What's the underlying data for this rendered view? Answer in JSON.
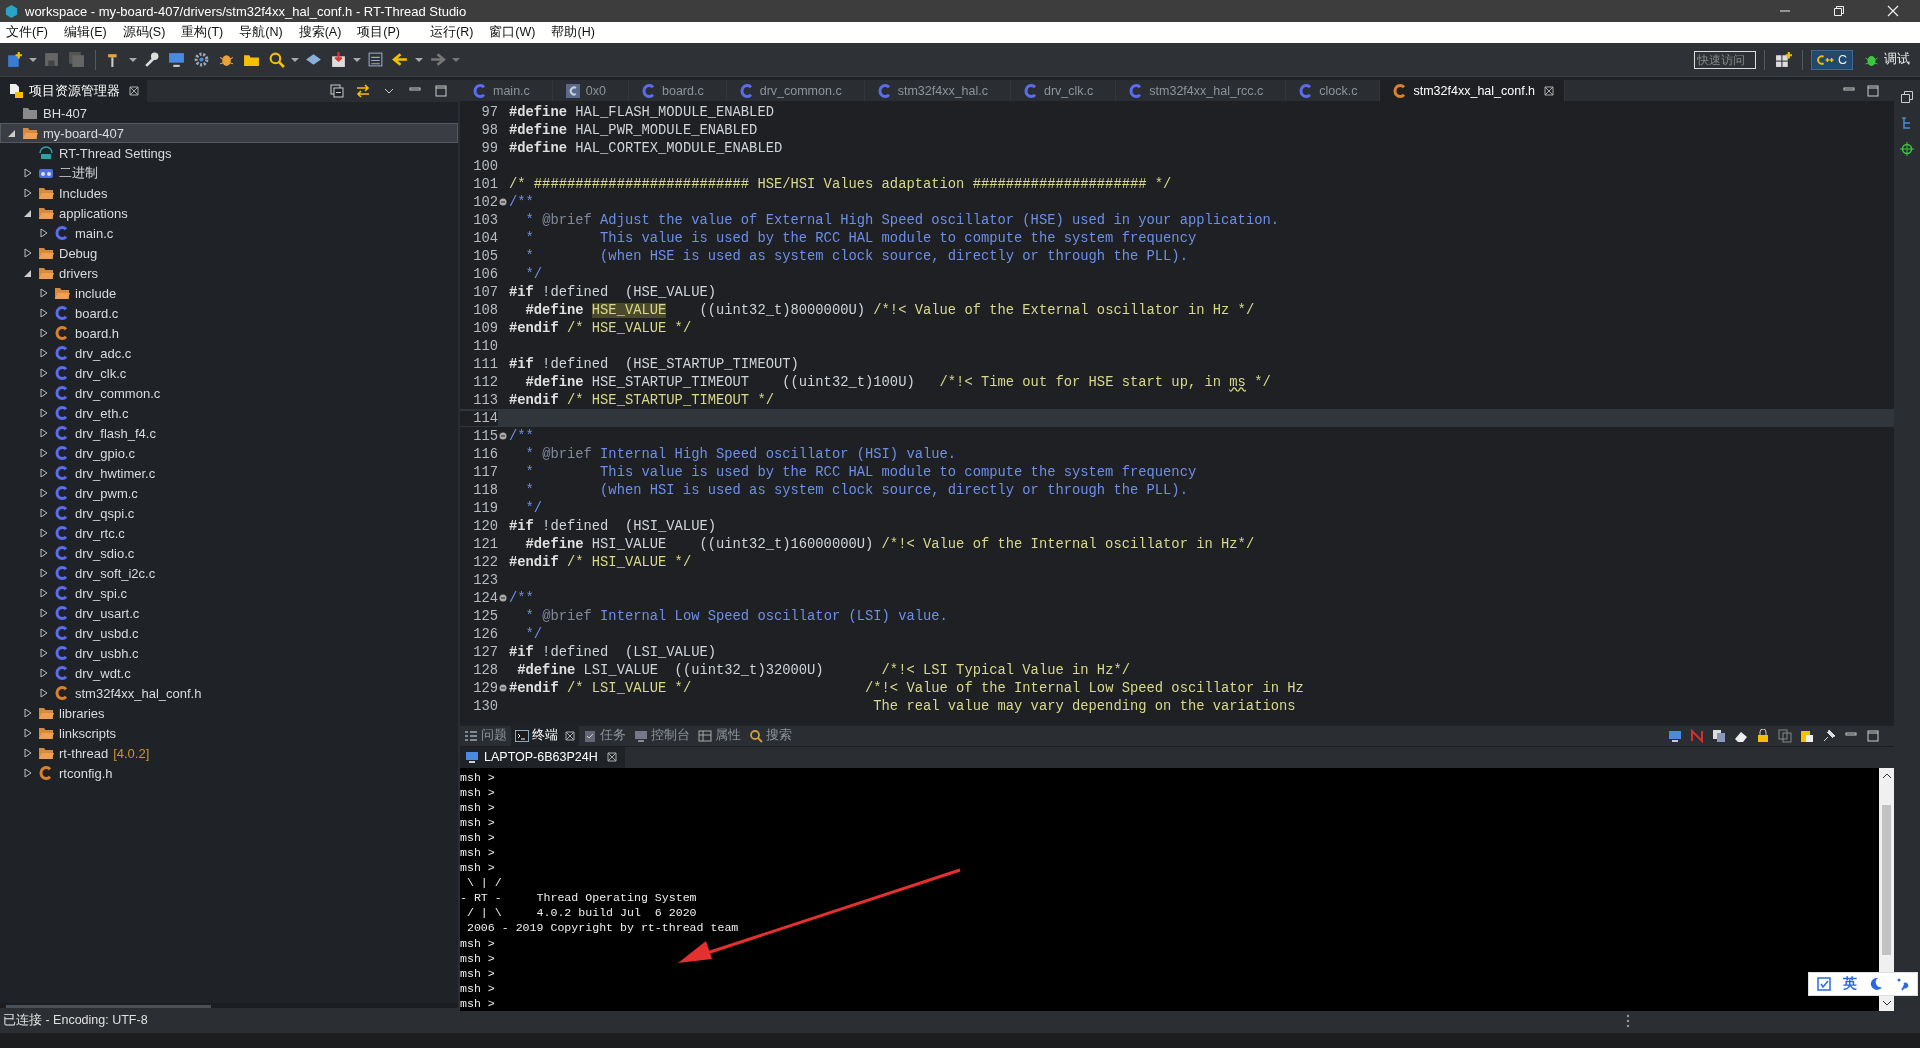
{
  "window": {
    "title": "workspace - my-board-407/drivers/stm32f4xx_hal_conf.h - RT-Thread Studio"
  },
  "menu": [
    "文件(F)",
    "编辑(E)",
    "源码(S)",
    "重构(T)",
    "导航(N)",
    "搜索(A)",
    "项目(P)",
    "运行(R)",
    "窗口(W)",
    "帮助(H)"
  ],
  "toolbar": {
    "quick_access": {
      "placeholder": "快速访问"
    },
    "perspectives": [
      {
        "label": "C",
        "kind": "cpp",
        "selected": true
      },
      {
        "label": "调试",
        "kind": "debug",
        "selected": false
      }
    ]
  },
  "explorer": {
    "title": "项目资源管理器",
    "items": [
      {
        "label": "BH-407",
        "kind": "closed-project",
        "selected": false
      },
      {
        "label": "my-board-407",
        "kind": "project",
        "selected": true,
        "expanded": true,
        "children": [
          {
            "label": "RT-Thread Settings",
            "kind": "settings",
            "selected": false
          },
          {
            "label": "二进制",
            "kind": "binaries",
            "selected": false,
            "expanded": false
          },
          {
            "label": "Includes",
            "kind": "includes",
            "selected": false,
            "expanded": false
          },
          {
            "label": "applications",
            "kind": "folder",
            "selected": false,
            "expanded": true,
            "children": [
              {
                "label": "main.c",
                "kind": "source",
                "selected": false,
                "expanded": false
              }
            ]
          },
          {
            "label": "Debug",
            "kind": "folder",
            "selected": false,
            "expanded": false
          },
          {
            "label": "drivers",
            "kind": "folder",
            "selected": false,
            "expanded": true,
            "children": [
              {
                "label": "include",
                "kind": "folder",
                "selected": false,
                "expanded": false
              },
              {
                "label": "board.c",
                "kind": "source",
                "selected": false,
                "expanded": false
              },
              {
                "label": "board.h",
                "kind": "header",
                "selected": false,
                "expanded": false
              },
              {
                "label": "drv_adc.c",
                "kind": "source",
                "selected": false,
                "expanded": false
              },
              {
                "label": "drv_clk.c",
                "kind": "source",
                "selected": false,
                "expanded": false
              },
              {
                "label": "drv_common.c",
                "kind": "source",
                "selected": false,
                "expanded": false
              },
              {
                "label": "drv_eth.c",
                "kind": "source",
                "selected": false,
                "expanded": false
              },
              {
                "label": "drv_flash_f4.c",
                "kind": "source",
                "selected": false,
                "expanded": false
              },
              {
                "label": "drv_gpio.c",
                "kind": "source",
                "selected": false,
                "expanded": false
              },
              {
                "label": "drv_hwtimer.c",
                "kind": "source",
                "selected": false,
                "expanded": false
              },
              {
                "label": "drv_pwm.c",
                "kind": "source",
                "selected": false,
                "expanded": false
              },
              {
                "label": "drv_qspi.c",
                "kind": "source",
                "selected": false,
                "expanded": false
              },
              {
                "label": "drv_rtc.c",
                "kind": "source",
                "selected": false,
                "expanded": false
              },
              {
                "label": "drv_sdio.c",
                "kind": "source",
                "selected": false,
                "expanded": false
              },
              {
                "label": "drv_soft_i2c.c",
                "kind": "source",
                "selected": false,
                "expanded": false
              },
              {
                "label": "drv_spi.c",
                "kind": "source",
                "selected": false,
                "expanded": false
              },
              {
                "label": "drv_usart.c",
                "kind": "source",
                "selected": false,
                "expanded": false
              },
              {
                "label": "drv_usbd.c",
                "kind": "source",
                "selected": false,
                "expanded": false
              },
              {
                "label": "drv_usbh.c",
                "kind": "source",
                "selected": false,
                "expanded": false
              },
              {
                "label": "drv_wdt.c",
                "kind": "source",
                "selected": false,
                "expanded": false
              },
              {
                "label": "stm32f4xx_hal_conf.h",
                "kind": "header",
                "selected": false,
                "expanded": false
              }
            ]
          },
          {
            "label": "libraries",
            "kind": "folder",
            "selected": false,
            "expanded": false
          },
          {
            "label": "linkscripts",
            "kind": "folder",
            "selected": false,
            "expanded": false
          },
          {
            "label": "rt-thread",
            "version": "[4.0.2]",
            "kind": "folder",
            "selected": false,
            "expanded": false
          },
          {
            "label": "rtconfig.h",
            "kind": "header",
            "selected": false,
            "expanded": false
          }
        ]
      }
    ]
  },
  "editor": {
    "tabs": [
      {
        "label": "main.c",
        "kind": "source",
        "selected": false
      },
      {
        "label": "0x0",
        "kind": "disassembly",
        "selected": false
      },
      {
        "label": "board.c",
        "kind": "source",
        "selected": false
      },
      {
        "label": "drv_common.c",
        "kind": "source",
        "selected": false
      },
      {
        "label": "stm32f4xx_hal.c",
        "kind": "source",
        "selected": false
      },
      {
        "label": "drv_clk.c",
        "kind": "source",
        "selected": false
      },
      {
        "label": "stm32f4xx_hal_rcc.c",
        "kind": "source",
        "selected": false
      },
      {
        "label": "clock.c",
        "kind": "source",
        "selected": false
      },
      {
        "label": "stm32f4xx_hal_conf.h",
        "kind": "header",
        "selected": true
      }
    ],
    "lines": [
      {
        "number": "97",
        "segments": [
          {
            "kind": "directive",
            "text": "#define"
          },
          {
            "kind": "plain",
            "text": " HAL_FLASH_MODULE_ENABLED"
          }
        ]
      },
      {
        "number": "98",
        "segments": [
          {
            "kind": "directive",
            "text": "#define"
          },
          {
            "kind": "plain",
            "text": " HAL_PWR_MODULE_ENABLED"
          }
        ]
      },
      {
        "number": "99",
        "segments": [
          {
            "kind": "directive",
            "text": "#define"
          },
          {
            "kind": "plain",
            "text": " HAL_CORTEX_MODULE_ENABLED"
          }
        ]
      },
      {
        "number": "100"
      },
      {
        "number": "101",
        "segments": [
          {
            "kind": "comment",
            "text": "/* ########################## HSE/HSI Values adaptation ##################### */"
          }
        ]
      },
      {
        "number": "102",
        "fold": true,
        "segments": [
          {
            "kind": "doc",
            "text": "/**"
          }
        ]
      },
      {
        "number": "103",
        "segments": [
          {
            "kind": "doc",
            "text": "  * "
          },
          {
            "kind": "doctag",
            "text": "@brief"
          },
          {
            "kind": "doc",
            "text": " Adjust the value of External High Speed oscillator (HSE) used in your application."
          }
        ]
      },
      {
        "number": "104",
        "segments": [
          {
            "kind": "doc",
            "text": "  *        This value is used by the RCC HAL module to compute the system frequency"
          }
        ]
      },
      {
        "number": "105",
        "segments": [
          {
            "kind": "doc",
            "text": "  *        (when HSE is used as system clock source, directly or through the PLL)."
          }
        ]
      },
      {
        "number": "106",
        "segments": [
          {
            "kind": "doc",
            "text": "  */"
          }
        ]
      },
      {
        "number": "107",
        "segments": [
          {
            "kind": "directive",
            "text": "#if"
          },
          {
            "kind": "plain",
            "text": " !defined  (HSE_VALUE)"
          }
        ]
      },
      {
        "number": "108",
        "segments": [
          {
            "kind": "directive",
            "text": "  #define "
          },
          {
            "kind": "match",
            "text": "HSE_VALUE"
          },
          {
            "kind": "plain",
            "text": "    ((uint32_t)8000000U) "
          },
          {
            "kind": "comment",
            "text": "/*!< Value of the External oscillator in Hz */"
          }
        ]
      },
      {
        "number": "109",
        "segments": [
          {
            "kind": "directive",
            "text": "#endif "
          },
          {
            "kind": "comment",
            "text": "/* HSE_VALUE */"
          }
        ]
      },
      {
        "number": "110"
      },
      {
        "number": "111",
        "segments": [
          {
            "kind": "directive",
            "text": "#if"
          },
          {
            "kind": "plain",
            "text": " !defined  (HSE_STARTUP_TIMEOUT)"
          }
        ]
      },
      {
        "number": "112",
        "segments": [
          {
            "kind": "directive",
            "text": "  #define"
          },
          {
            "kind": "plain",
            "text": " HSE_STARTUP_TIMEOUT    ((uint32_t)100U)   "
          },
          {
            "kind": "comment",
            "text": "/*!< Time out for HSE start up, in "
          },
          {
            "kind": "misspelled",
            "text": "ms"
          },
          {
            "kind": "comment",
            "text": " */"
          }
        ]
      },
      {
        "number": "113",
        "segments": [
          {
            "kind": "directive",
            "text": "#endif "
          },
          {
            "kind": "comment",
            "text": "/* HSE_STARTUP_TIMEOUT */"
          }
        ]
      },
      {
        "number": "114",
        "current": true
      },
      {
        "number": "115",
        "fold": true,
        "segments": [
          {
            "kind": "doc",
            "text": "/**"
          }
        ]
      },
      {
        "number": "116",
        "segments": [
          {
            "kind": "doc",
            "text": "  * "
          },
          {
            "kind": "doctag",
            "text": "@brief"
          },
          {
            "kind": "doc",
            "text": " Internal High Speed oscillator (HSI) value."
          }
        ]
      },
      {
        "number": "117",
        "segments": [
          {
            "kind": "doc",
            "text": "  *        This value is used by the RCC HAL module to compute the system frequency"
          }
        ]
      },
      {
        "number": "118",
        "segments": [
          {
            "kind": "doc",
            "text": "  *        (when HSI is used as system clock source, directly or through the PLL)."
          }
        ]
      },
      {
        "number": "119",
        "segments": [
          {
            "kind": "doc",
            "text": "  */"
          }
        ]
      },
      {
        "number": "120",
        "segments": [
          {
            "kind": "directive",
            "text": "#if"
          },
          {
            "kind": "plain",
            "text": " !defined  (HSI_VALUE)"
          }
        ]
      },
      {
        "number": "121",
        "segments": [
          {
            "kind": "directive",
            "text": "  #define"
          },
          {
            "kind": "plain",
            "text": " HSI_VALUE    ((uint32_t)16000000U) "
          },
          {
            "kind": "comment",
            "text": "/*!< Value of the Internal oscillator in Hz*/"
          }
        ]
      },
      {
        "number": "122",
        "segments": [
          {
            "kind": "directive",
            "text": "#endif "
          },
          {
            "kind": "comment",
            "text": "/* HSI_VALUE */"
          }
        ]
      },
      {
        "number": "123"
      },
      {
        "number": "124",
        "fold": true,
        "segments": [
          {
            "kind": "doc",
            "text": "/**"
          }
        ]
      },
      {
        "number": "125",
        "segments": [
          {
            "kind": "doc",
            "text": "  * "
          },
          {
            "kind": "doctag",
            "text": "@brief"
          },
          {
            "kind": "doc",
            "text": " Internal Low Speed oscillator (LSI) value."
          }
        ]
      },
      {
        "number": "126",
        "segments": [
          {
            "kind": "doc",
            "text": "  */"
          }
        ]
      },
      {
        "number": "127",
        "segments": [
          {
            "kind": "directive",
            "text": "#if"
          },
          {
            "kind": "plain",
            "text": " !defined  (LSI_VALUE)"
          }
        ]
      },
      {
        "number": "128",
        "segments": [
          {
            "kind": "directive",
            "text": " #define"
          },
          {
            "kind": "plain",
            "text": " LSI_VALUE  ((uint32_t)32000U)       "
          },
          {
            "kind": "comment",
            "text": "/*!< LSI Typical Value in Hz*/"
          }
        ]
      },
      {
        "number": "129",
        "fold": true,
        "segments": [
          {
            "kind": "directive",
            "text": "#endif "
          },
          {
            "kind": "comment",
            "text": "/* LSI_VALUE */                     /*!< Value of the Internal Low Speed oscillator in Hz"
          }
        ]
      },
      {
        "number": "130",
        "segments": [
          {
            "kind": "comment",
            "text": "                                            The real value may vary depending on the variations"
          }
        ]
      }
    ]
  },
  "bottom_panel": {
    "views": [
      {
        "label": "问题",
        "kind": "problems",
        "selected": false
      },
      {
        "label": "终端",
        "kind": "terminal",
        "selected": true
      },
      {
        "label": "任务",
        "kind": "tasks",
        "selected": false
      },
      {
        "label": "控制台",
        "kind": "console",
        "selected": false
      },
      {
        "label": "属性",
        "kind": "properties",
        "selected": false
      },
      {
        "label": "搜索",
        "kind": "search",
        "selected": false
      }
    ],
    "terminal_tab": {
      "label": "LAPTOP-6B63P24H",
      "selected": true
    },
    "terminal_lines": [
      "msh >",
      "msh >",
      "msh >",
      "msh >",
      "msh >",
      "msh >",
      "msh >",
      " \\ | /",
      "- RT -     Thread Operating System",
      " / | \\     4.0.2 build Jul  6 2020",
      " 2006 - 2019 Copyright by rt-thread team",
      "msh >",
      "msh >",
      "msh >",
      "msh >",
      "msh >"
    ]
  },
  "status_bar": {
    "text": "已连接 - Encoding: UTF-8"
  },
  "ime_bar": {
    "language": "英"
  }
}
